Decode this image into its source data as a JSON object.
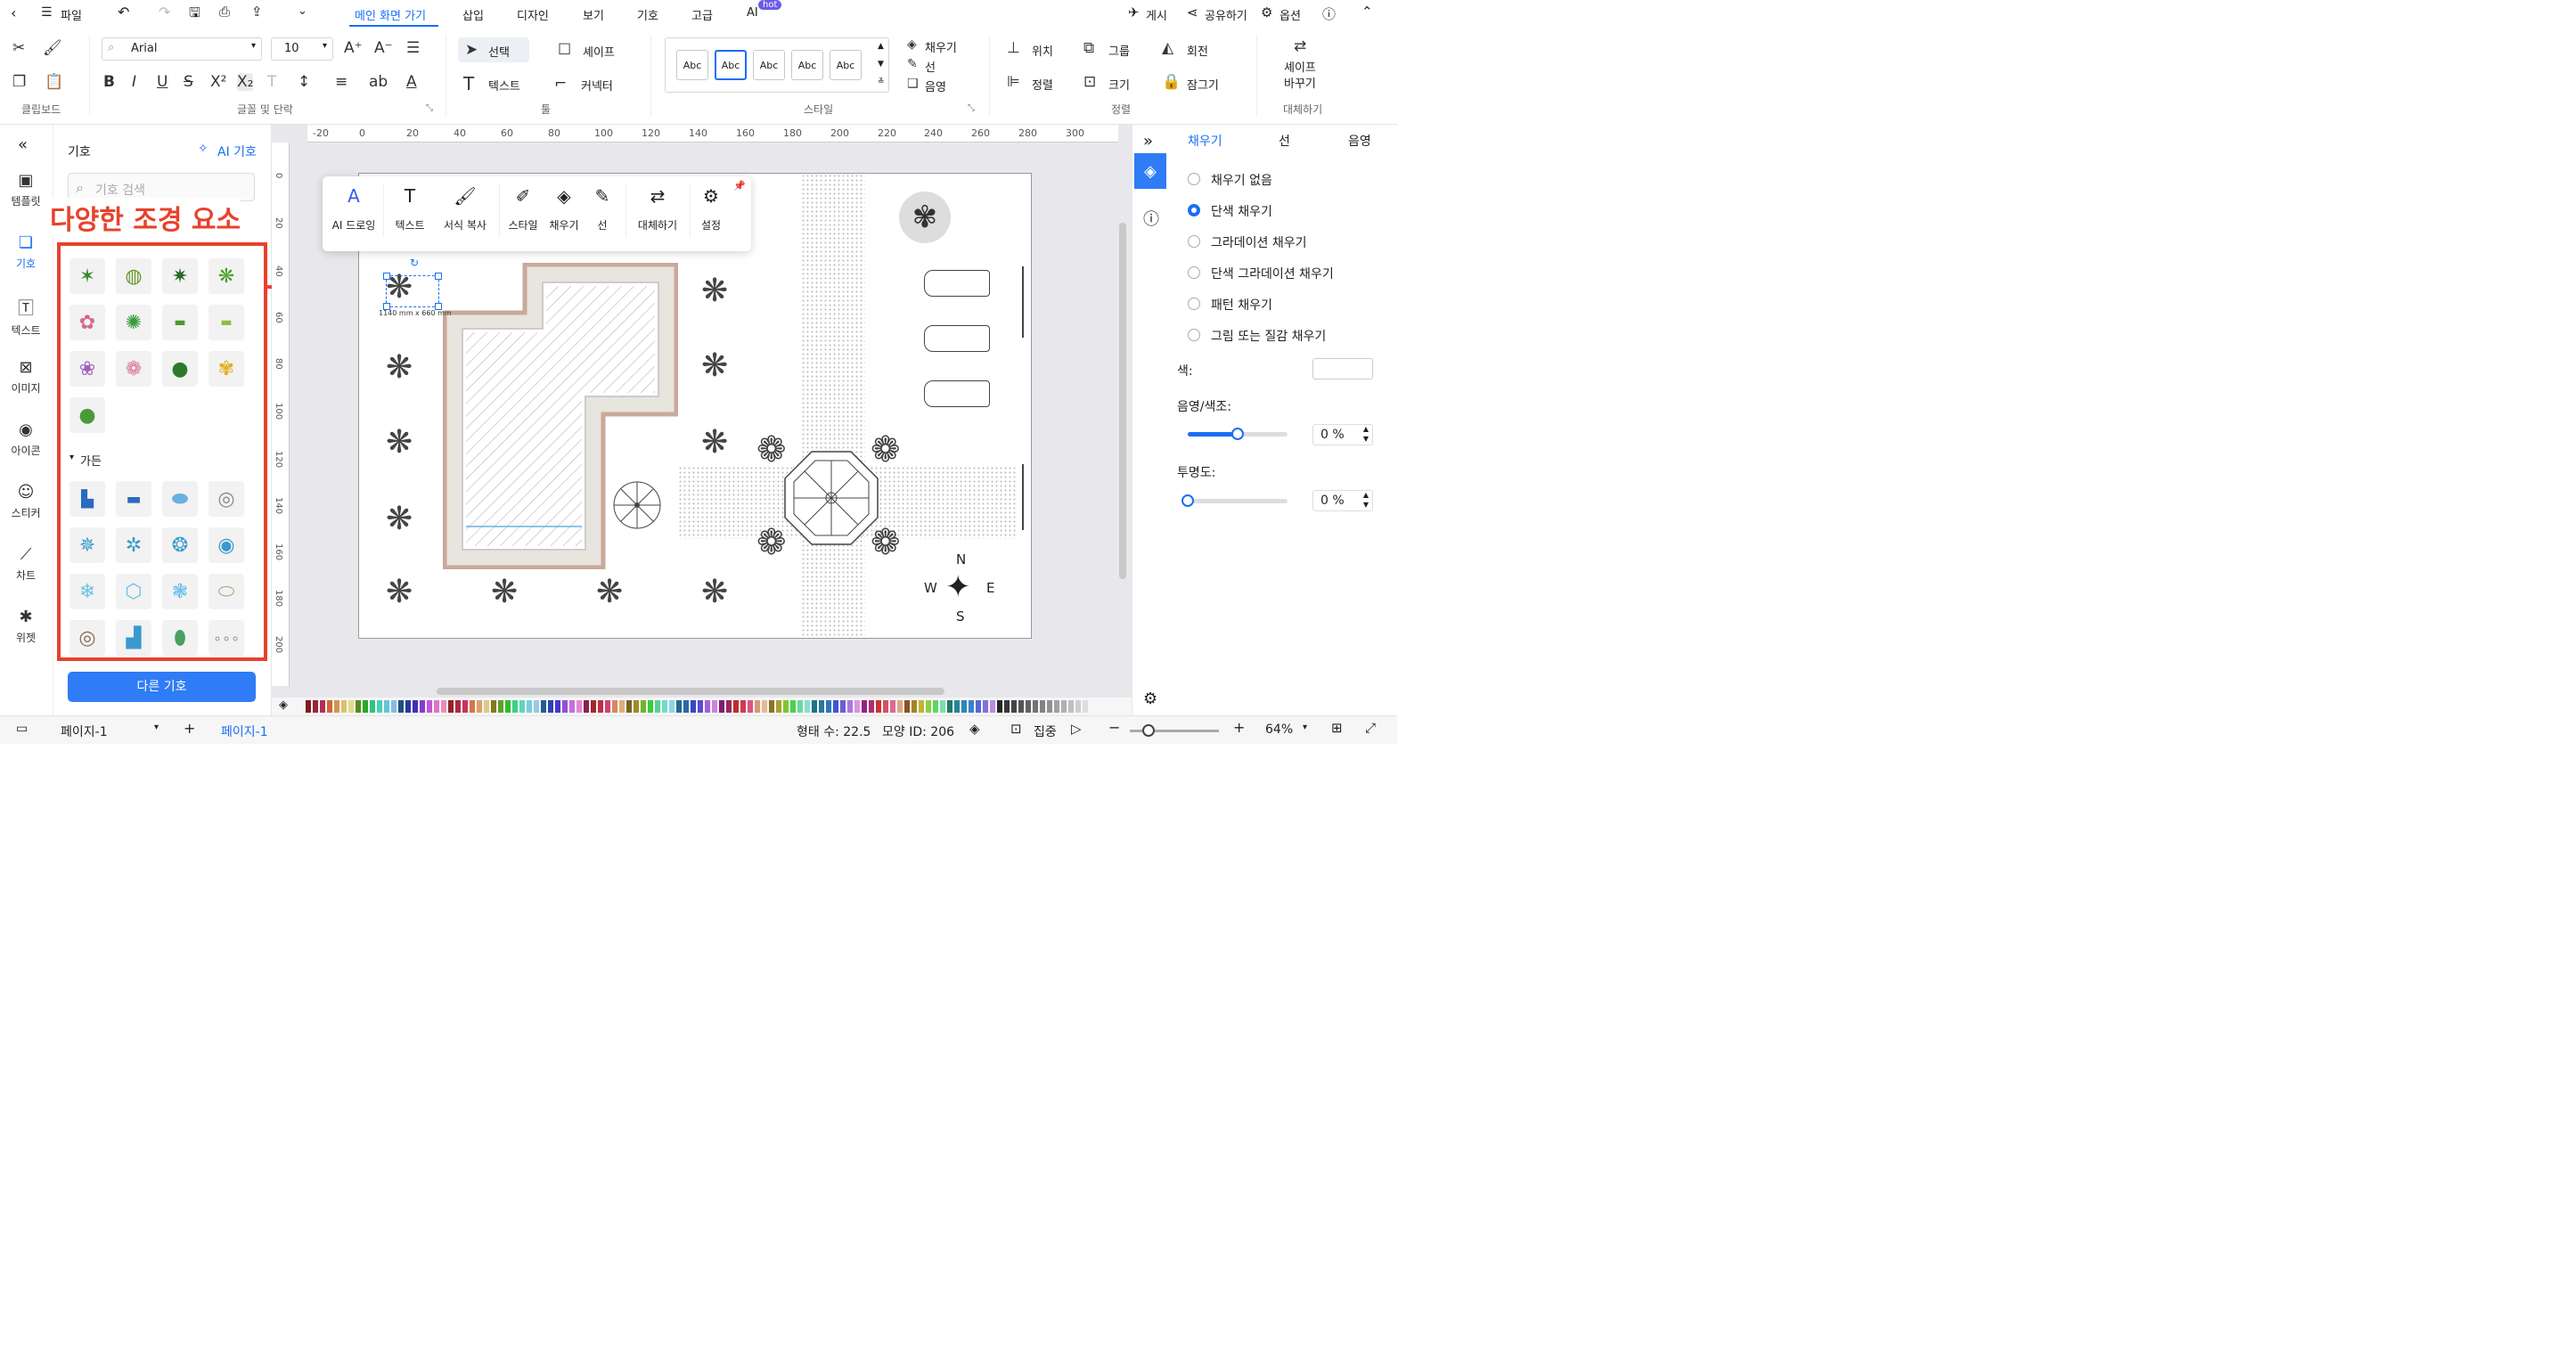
{
  "topbar": {
    "file": "파일",
    "tabs": [
      "메인 화면 가기",
      "삽입",
      "디자인",
      "보기",
      "기호",
      "고급",
      "AI"
    ],
    "hot_badge": "hot",
    "publish": "게시",
    "share": "공유하기",
    "options": "옵션"
  },
  "ribbon": {
    "font_family": "Arial",
    "font_size": "10",
    "select_label": "선택",
    "shape_label": "셰이프",
    "text_label": "텍스트",
    "connector_label": "커넥터",
    "style_samples": [
      "Abc",
      "Abc",
      "Abc",
      "Abc",
      "Abc"
    ],
    "fill_label": "채우기",
    "line_label": "선",
    "shadow_label": "음영",
    "position_label": "위치",
    "group_label": "그룹",
    "rotate_label": "회전",
    "align_label": "정렬",
    "size_label": "크기",
    "lock_label": "잠그기",
    "replace_shape_line1": "셰이프",
    "replace_shape_line2": "바꾸기",
    "groups": {
      "clipboard": "클립보드",
      "font": "글꼴 및 단락",
      "tools": "툴",
      "style": "스타일",
      "arrange": "정렬",
      "replace": "대체하기"
    }
  },
  "left_rail": {
    "items": [
      "템플릿",
      "기호",
      "텍스트",
      "이미지",
      "아이콘",
      "스티커",
      "차트",
      "위젯"
    ]
  },
  "symbol_panel": {
    "title": "기호",
    "ai_symbol": "AI 기호",
    "search_placeholder": "기호 검색",
    "annotation": "다양한 조경 요소",
    "garden_section": "가든",
    "more_symbols": "다른 기호"
  },
  "float_toolbar": {
    "items": [
      "AI 드로잉",
      "텍스트",
      "서식 복사",
      "스타일",
      "채우기",
      "선",
      "대체하기",
      "설정"
    ]
  },
  "canvas": {
    "ruler_top": [
      "-20",
      "0",
      "20",
      "40",
      "60",
      "80",
      "100",
      "120",
      "140",
      "160",
      "180",
      "200",
      "220",
      "240",
      "260",
      "280",
      "300"
    ],
    "ruler_left": [
      "0",
      "20",
      "40",
      "60",
      "80",
      "100",
      "120",
      "140",
      "160",
      "180",
      "200"
    ],
    "selection_size": "1140 mm x 660 mm",
    "compass": {
      "n": "N",
      "s": "S",
      "e": "E",
      "w": "W"
    }
  },
  "right_panel": {
    "tabs": [
      "채우기",
      "선",
      "음영"
    ],
    "fill_options": [
      "채우기 없음",
      "단색 채우기",
      "그라데이션 채우기",
      "단색 그라데이션 채우기",
      "패턴 채우기",
      "그림 또는 질감 채우기"
    ],
    "selected_option": 1,
    "color_label": "색:",
    "shade_label": "음영/색조:",
    "shade_value": "0 %",
    "shade_level": 0.5,
    "transparency_label": "투명도:",
    "transparency_value": "0 %",
    "transparency_level": 0
  },
  "statusbar": {
    "page_select": "페이지-1",
    "page_tab": "페이지-1",
    "shape_count": "형태 수: 22.5",
    "shape_id": "모양 ID: 206",
    "focus": "집중",
    "zoom": "64%"
  },
  "colors": {
    "accent": "#1a6ef5",
    "annotation_red": "#e8412c",
    "pool_edge": "#c9a99a"
  }
}
